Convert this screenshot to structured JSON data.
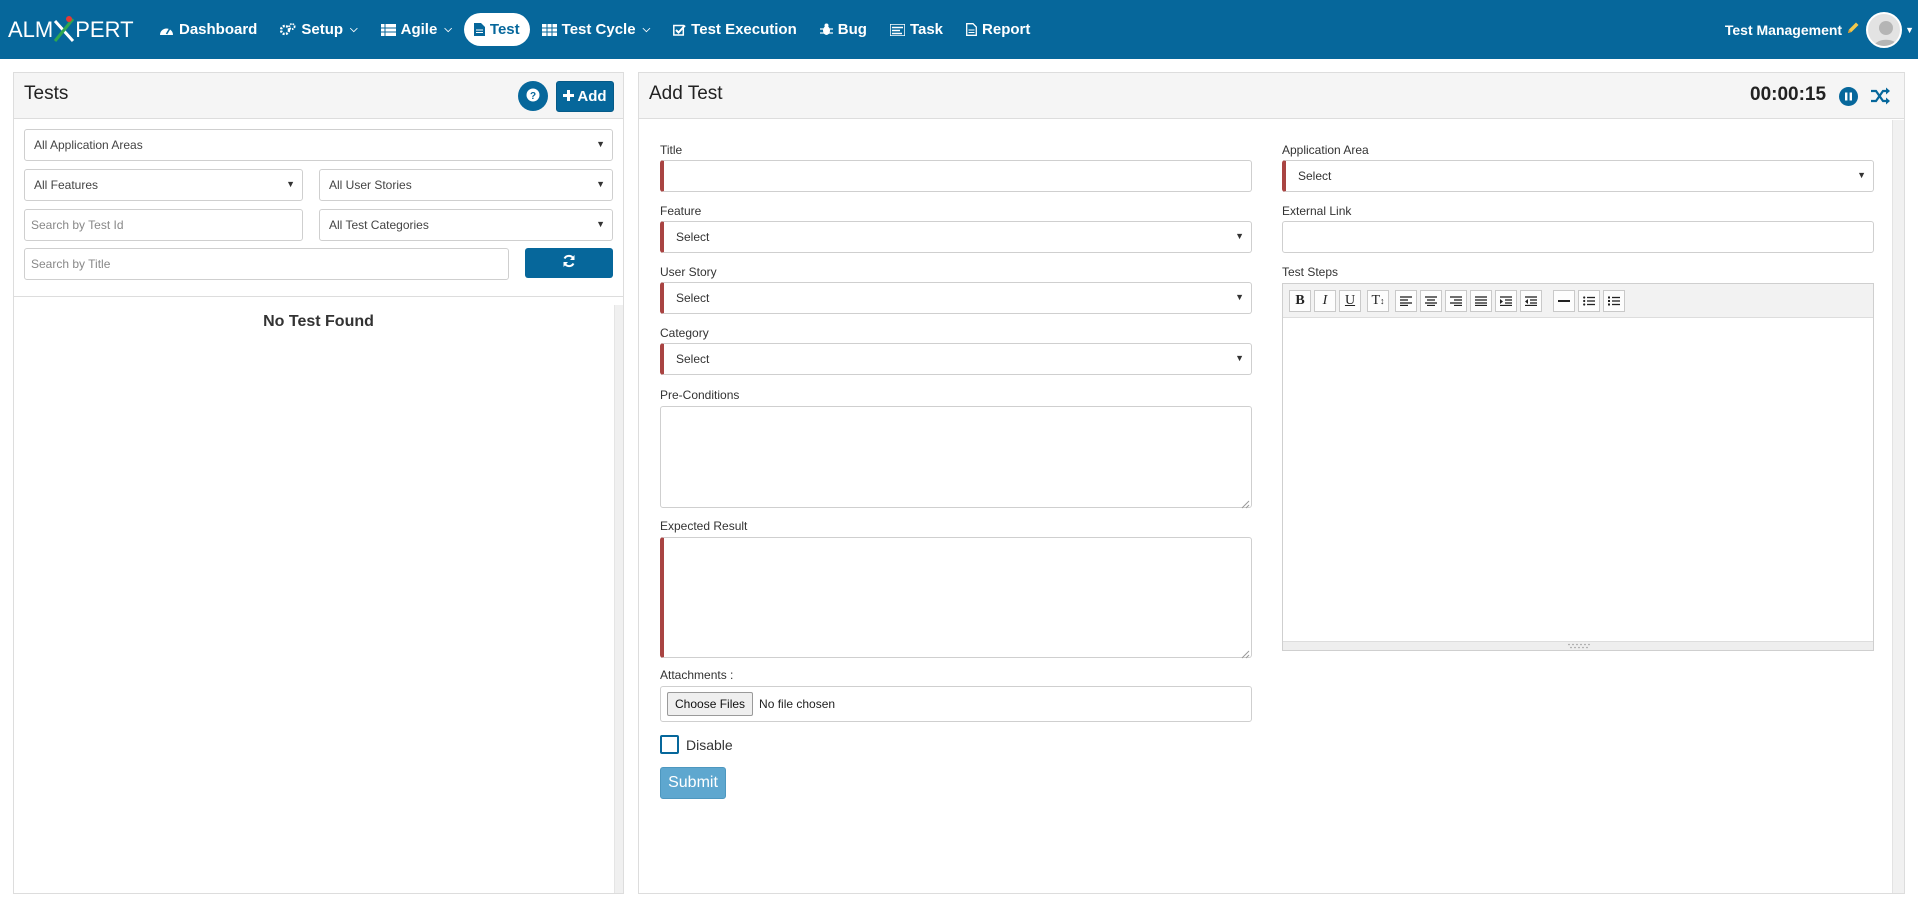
{
  "brand": {
    "left": "ALM",
    "right": "PERT"
  },
  "nav": {
    "dashboard": "Dashboard",
    "setup": "Setup",
    "agile": "Agile",
    "test": "Test",
    "test_cycle": "Test Cycle",
    "test_execution": "Test Execution",
    "bug": "Bug",
    "task": "Task",
    "report": "Report"
  },
  "user": {
    "label": "Test Management"
  },
  "left_panel": {
    "title": "Tests",
    "add_label": "Add",
    "filters": {
      "application_area": "All Application Areas",
      "features": "All Features",
      "user_stories": "All User Stories",
      "search_test_id_placeholder": "Search by Test Id",
      "test_categories": "All Test Categories",
      "search_title_placeholder": "Search by Title"
    },
    "empty_message": "No Test Found"
  },
  "right_panel": {
    "title": "Add Test",
    "timer": "00:00:15",
    "form": {
      "title_label": "Title",
      "application_area_label": "Application Area",
      "application_area_value": "Select",
      "feature_label": "Feature",
      "feature_value": "Select",
      "external_link_label": "External Link",
      "user_story_label": "User Story",
      "user_story_value": "Select",
      "test_steps_label": "Test Steps",
      "category_label": "Category",
      "category_value": "Select",
      "preconditions_label": "Pre-Conditions",
      "expected_result_label": "Expected Result",
      "attachments_label": "Attachments :",
      "choose_files": "Choose Files",
      "no_file": "No file chosen",
      "disable_label": "Disable",
      "submit_label": "Submit"
    },
    "toolbar": {
      "bold": "B",
      "italic": "I",
      "underline": "U",
      "font_size": "T"
    }
  },
  "colors": {
    "primary": "#06679b",
    "required": "#a94442",
    "submit": "#5ea7cf"
  },
  "icons": [
    "dashboard-icon",
    "setup-icon",
    "agile-icon",
    "test-icon",
    "test-cycle-icon",
    "test-execution-icon",
    "bug-icon",
    "task-icon",
    "report-icon",
    "pencil-icon",
    "help-icon",
    "plus-icon",
    "refresh-icon",
    "pause-icon",
    "shuffle-icon"
  ]
}
